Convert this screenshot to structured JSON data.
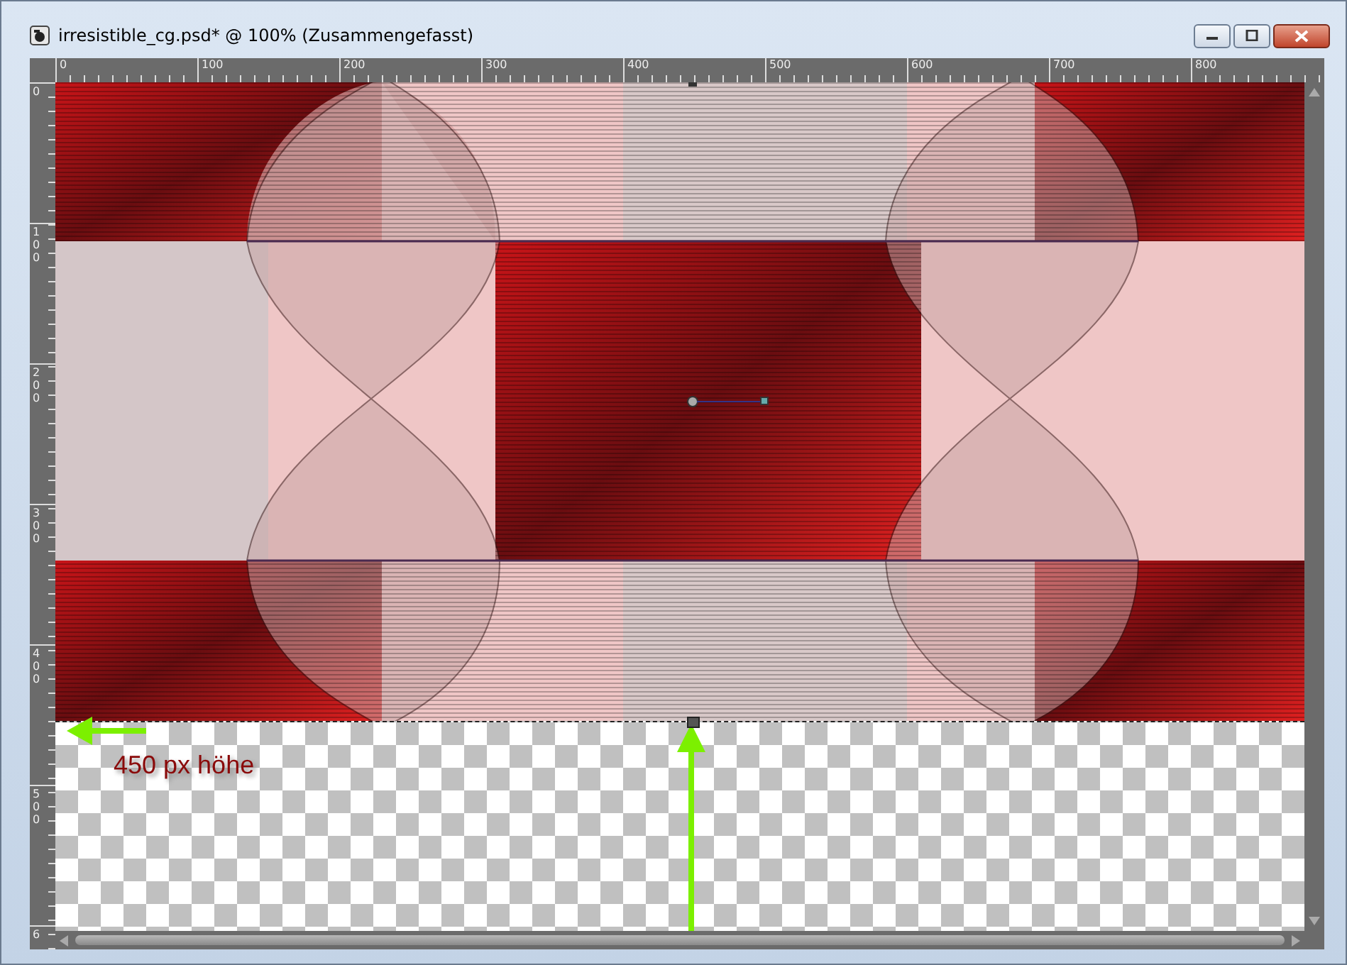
{
  "window": {
    "title": "irresistible_cg.psd* @ 100% (Zusammengefasst)"
  },
  "ruler_top": {
    "labels": [
      "0",
      "100",
      "200",
      "300",
      "400",
      "500",
      "600",
      "700",
      "800"
    ]
  },
  "ruler_left": {
    "labels": [
      "0",
      "100",
      "200",
      "300",
      "400",
      "500",
      "6"
    ]
  },
  "annotation": {
    "label": "450 px höhe"
  }
}
